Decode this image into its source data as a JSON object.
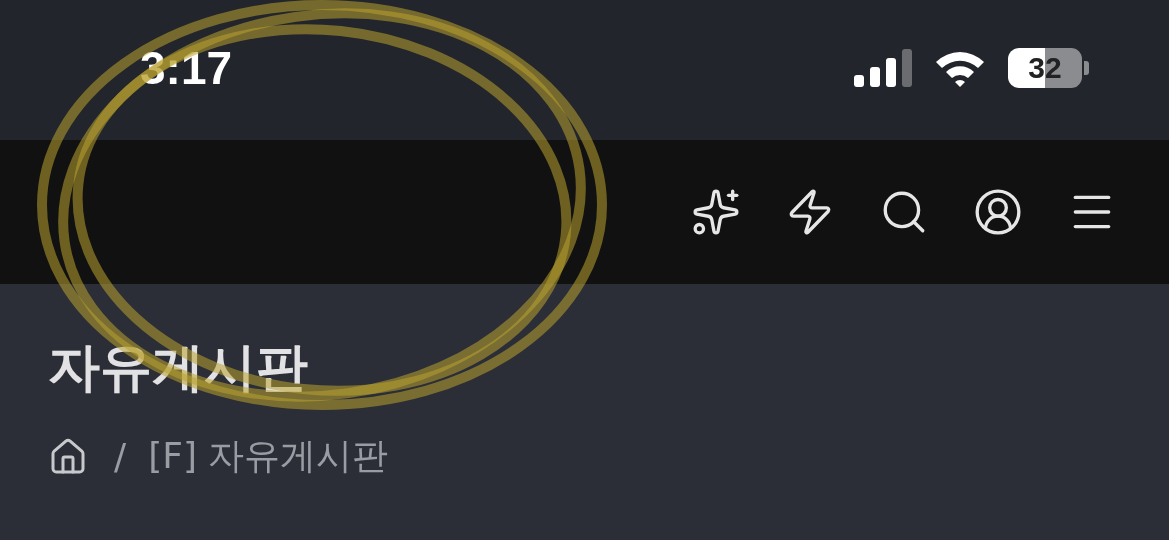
{
  "status_bar": {
    "time": "3:17",
    "battery": "32"
  },
  "page": {
    "title": "자유게시판",
    "breadcrumb": {
      "separator": "/",
      "current": "[F] 자유게시판"
    }
  }
}
